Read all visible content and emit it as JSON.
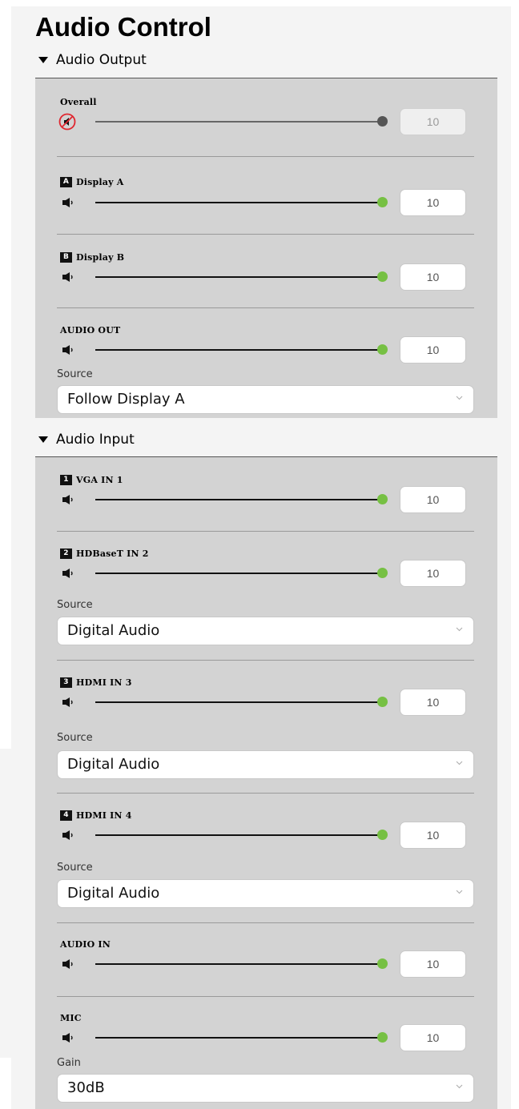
{
  "page": {
    "title": "Audio Control"
  },
  "output": {
    "header": "Audio Output",
    "overall": {
      "label": "Overall",
      "value": "10",
      "muted": true,
      "level": 1.0
    },
    "display_a": {
      "badge": "A",
      "label": "Display A",
      "value": "10",
      "level": 1.0
    },
    "display_b": {
      "badge": "B",
      "label": "Display B",
      "value": "10",
      "level": 1.0
    },
    "audio_out": {
      "label": "AUDIO OUT",
      "value": "10",
      "level": 1.0,
      "source_label": "Source",
      "source_value": "Follow Display A"
    }
  },
  "input": {
    "header": "Audio Input",
    "vga_in_1": {
      "badge": "1",
      "label": "VGA IN 1",
      "value": "10",
      "level": 1.0
    },
    "hdbaset_in_2": {
      "badge": "2",
      "label": "HDBaseT IN 2",
      "value": "10",
      "level": 1.0,
      "source_label": "Source",
      "source_value": "Digital Audio"
    },
    "hdmi_in_3": {
      "badge": "3",
      "label": "HDMI IN 3",
      "value": "10",
      "level": 1.0,
      "source_label": "Source",
      "source_value": "Digital Audio"
    },
    "hdmi_in_4": {
      "badge": "4",
      "label": "HDMI IN 4",
      "value": "10",
      "level": 1.0,
      "source_label": "Source",
      "source_value": "Digital Audio"
    },
    "audio_in": {
      "label": "AUDIO IN",
      "value": "10",
      "level": 1.0
    },
    "mic": {
      "label": "MIC",
      "value": "10",
      "level": 1.0,
      "gain_label": "Gain",
      "gain_value": "30dB"
    }
  },
  "colors": {
    "accent": "#76c043",
    "panel": "#d3d3d3",
    "mute": "#e0262f"
  },
  "icons": {
    "speaker": "speaker-icon",
    "mute": "mute-icon",
    "chevron": "chevron-down-icon",
    "caret": "caret-down-icon"
  }
}
